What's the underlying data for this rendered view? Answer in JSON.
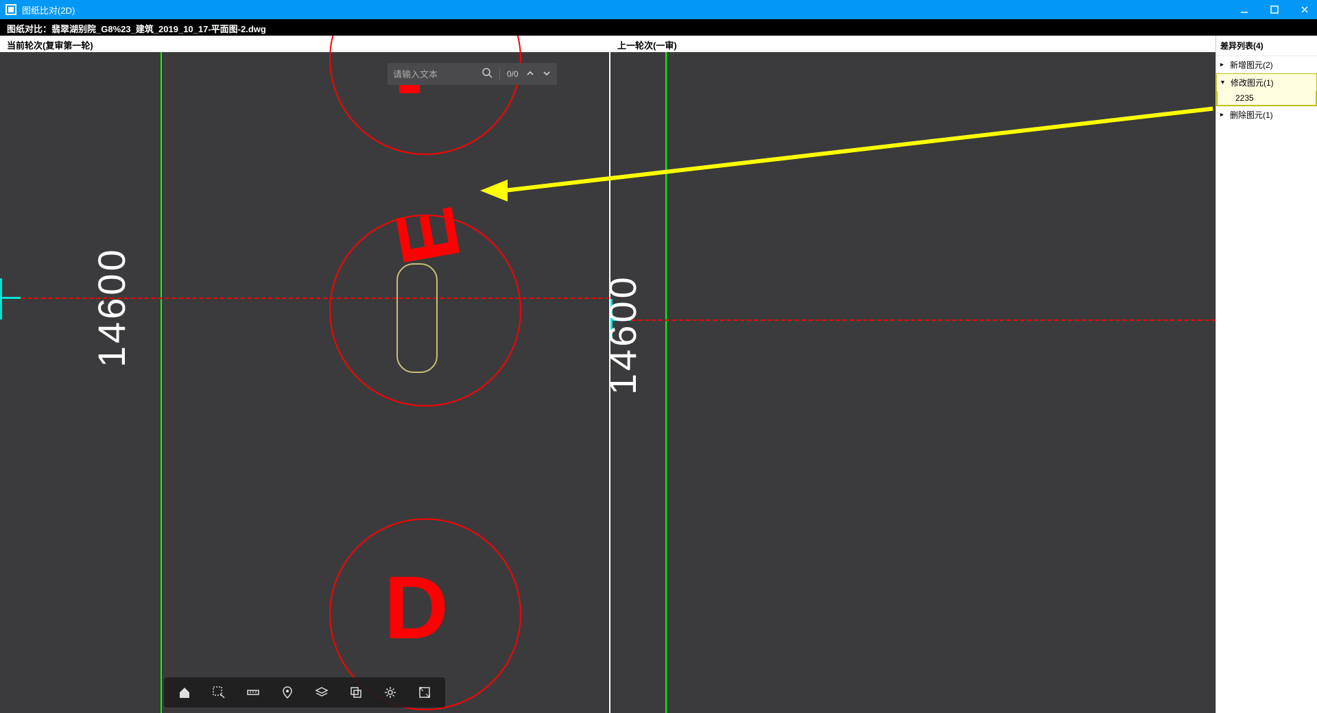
{
  "titlebar": {
    "title": "图纸比对(2D)"
  },
  "subtitle": "图纸对比：翡翠湖别院_G8%23_建筑_2019_10_17-平面图-2.dwg",
  "viewport_left_header": "当前轮次(复审第一轮)",
  "viewport_right_header": "上一轮次(一审)",
  "left_dim": "14600",
  "right_dim": "14600",
  "left_d_char": "D",
  "left_e_char": "E",
  "search": {
    "placeholder": "请输入文本",
    "count": "0/0"
  },
  "sidebar": {
    "header": "差异列表(4)",
    "items": [
      {
        "label": "新增图元(2)",
        "expanded": false,
        "selected": false
      },
      {
        "label": "修改图元(1)",
        "expanded": true,
        "selected": true,
        "children": [
          "2235"
        ]
      },
      {
        "label": "删除图元(1)",
        "expanded": false,
        "selected": false
      }
    ]
  }
}
